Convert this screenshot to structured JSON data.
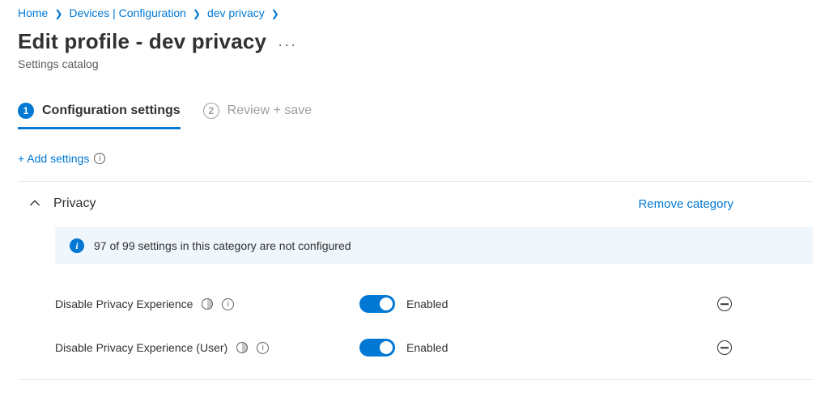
{
  "breadcrumb": {
    "items": [
      {
        "label": "Home"
      },
      {
        "label": "Devices | Configuration"
      },
      {
        "label": "dev privacy"
      }
    ]
  },
  "header": {
    "title": "Edit profile - dev privacy",
    "subtitle": "Settings catalog"
  },
  "tabs": [
    {
      "num": "1",
      "label": "Configuration settings",
      "active": true
    },
    {
      "num": "2",
      "label": "Review + save",
      "active": false
    }
  ],
  "actions": {
    "add_settings": "+ Add settings"
  },
  "category": {
    "title": "Privacy",
    "remove_label": "Remove category",
    "info_bar": "97 of 99 settings in this category are not configured",
    "settings": [
      {
        "label": "Disable Privacy Experience",
        "state_label": "Enabled",
        "enabled": true
      },
      {
        "label": "Disable Privacy Experience (User)",
        "state_label": "Enabled",
        "enabled": true
      }
    ]
  }
}
